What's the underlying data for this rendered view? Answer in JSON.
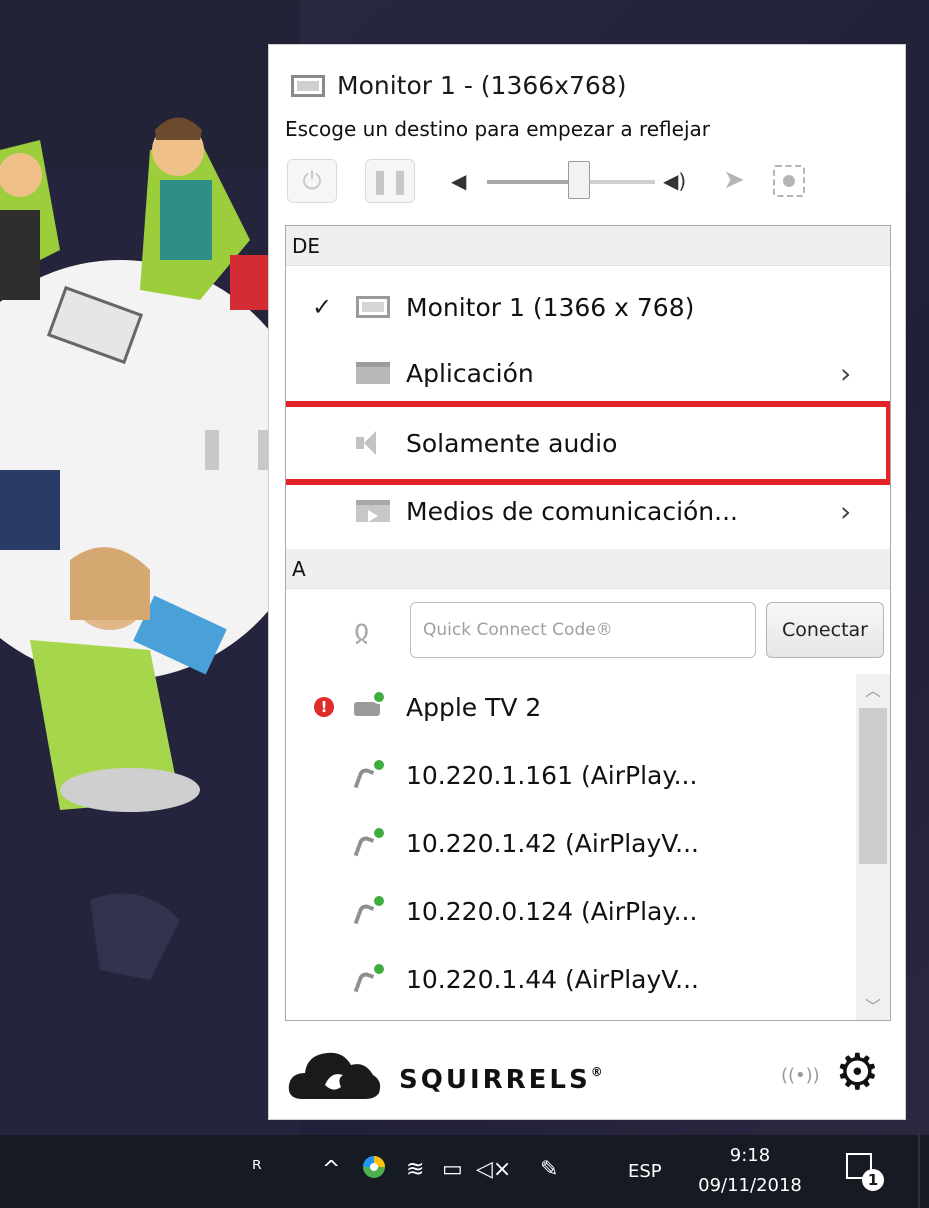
{
  "popup": {
    "title": "Monitor 1 - (1366x768)",
    "subtitle": "Escoge un destino para empezar a reflejar",
    "volume_level": 0.55
  },
  "source": {
    "header": "DE",
    "items": [
      {
        "label": "Monitor 1 (1366 x 768)",
        "checked": true,
        "icon": "monitor-icon"
      },
      {
        "label": "Aplicación",
        "has_submenu": true,
        "icon": "window-icon"
      },
      {
        "label": "Solamente audio",
        "highlighted": true,
        "icon": "speaker-icon"
      },
      {
        "label": "Medios de comunicación...",
        "has_submenu": true,
        "icon": "media-icon"
      }
    ]
  },
  "destination": {
    "header": "A",
    "quick_connect": {
      "placeholder": "Quick Connect Code®",
      "button": "Conectar"
    },
    "devices": [
      {
        "label": "Apple TV 2",
        "alert": true,
        "icon": "apple-tv-icon"
      },
      {
        "label": "10.220.1.161 (AirPlay...",
        "icon": "airplay-icon"
      },
      {
        "label": "10.220.1.42 (AirPlayV...",
        "icon": "airplay-icon"
      },
      {
        "label": "10.220.0.124 (AirPlay...",
        "icon": "airplay-icon"
      },
      {
        "label": "10.220.1.44 (AirPlayV...",
        "icon": "airplay-icon"
      }
    ]
  },
  "footer": {
    "brand": "SQUIRRELS",
    "brand_mark": "®"
  },
  "taskbar": {
    "language": "ESP",
    "time": "9:18",
    "date": "09/11/2018",
    "notifications": "1"
  },
  "colors": {
    "highlight": "#e32229",
    "online": "#3fae3f",
    "alert": "#e02b2b"
  }
}
